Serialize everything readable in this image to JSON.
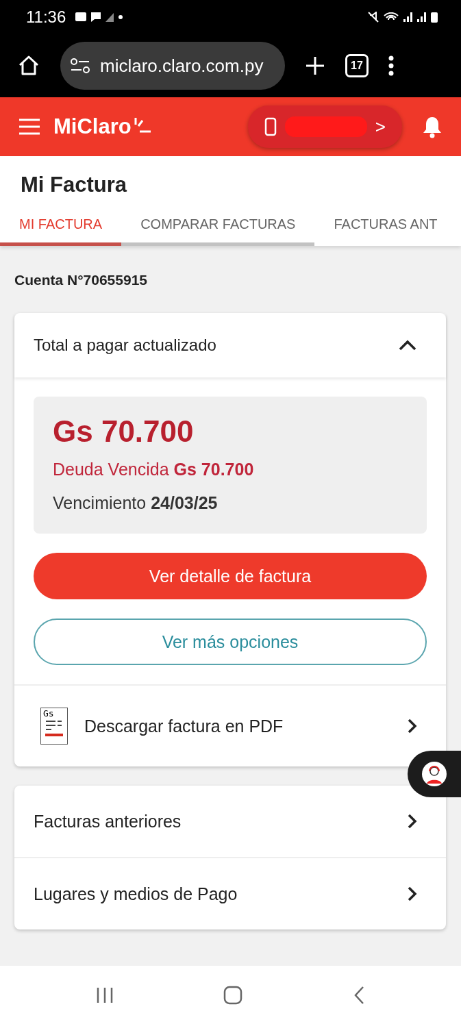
{
  "status_bar": {
    "time": "11:36"
  },
  "browser": {
    "url": "miclaro.claro.com.py",
    "tab_count": "17"
  },
  "header": {
    "logo": "MiClaro",
    "line_button": {
      "arrow": ">"
    }
  },
  "page_title": "Mi Factura",
  "tabs": [
    {
      "label": "MI FACTURA",
      "selected": true
    },
    {
      "label": "COMPARAR FACTURAS",
      "selected": false
    },
    {
      "label": "FACTURAS ANT",
      "selected": false
    }
  ],
  "account": "Cuenta N°70655915",
  "bill_card": {
    "title": "Total a pagar actualizado",
    "expanded": true,
    "amount": "Gs 70.700",
    "overdue": "Deuda Vencida **Gs 70.700**",
    "due": "Vencimiento **24/03/25**",
    "primary_button": "Ver detalle de factura",
    "secondary_button": "Ver más opciones",
    "download": {
      "icon_label": "Gs",
      "label": "Descargar factura en PDF"
    }
  },
  "links": [
    {
      "label": "Facturas anteriores"
    },
    {
      "label": "Lugares y medios de Pago"
    }
  ]
}
